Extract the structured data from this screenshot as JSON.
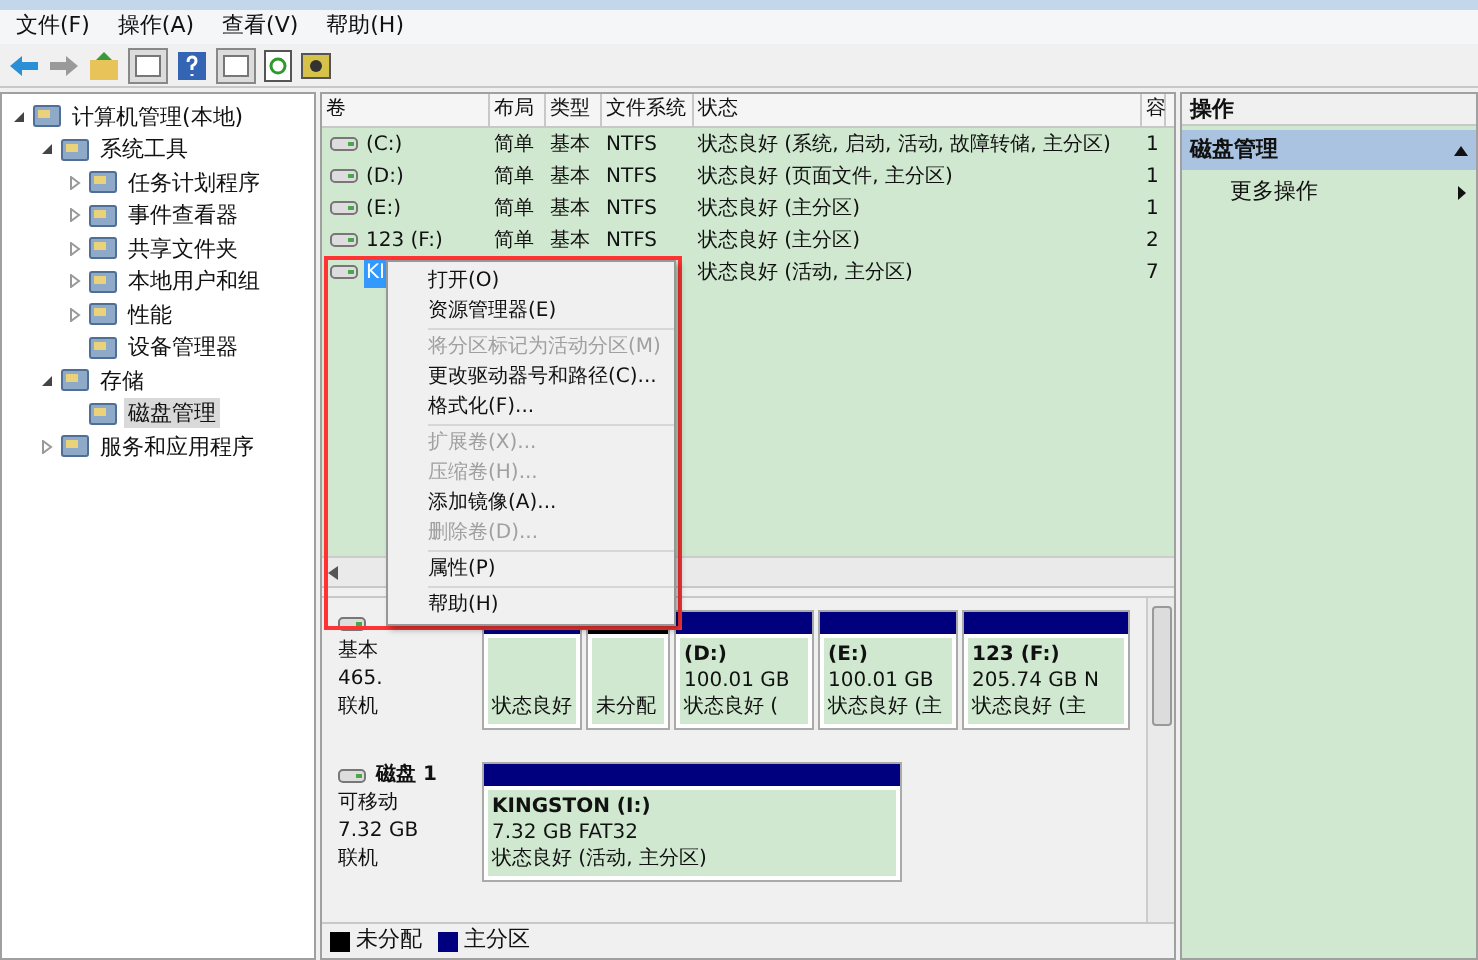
{
  "menubar": [
    "文件(F)",
    "操作(A)",
    "查看(V)",
    "帮助(H)"
  ],
  "tree": [
    {
      "label": "计算机管理(本地)",
      "expanded": true,
      "selected": false,
      "children": [
        {
          "label": "系统工具",
          "expanded": true,
          "selected": false,
          "children": [
            {
              "label": "任务计划程序",
              "expanded": false,
              "selected": false
            },
            {
              "label": "事件查看器",
              "expanded": false,
              "selected": false
            },
            {
              "label": "共享文件夹",
              "expanded": false,
              "selected": false
            },
            {
              "label": "本地用户和组",
              "expanded": false,
              "selected": false
            },
            {
              "label": "性能",
              "expanded": false,
              "selected": false
            },
            {
              "label": "设备管理器",
              "selected": false
            }
          ]
        },
        {
          "label": "存储",
          "expanded": true,
          "selected": false,
          "children": [
            {
              "label": "磁盘管理",
              "selected": true
            }
          ]
        },
        {
          "label": "服务和应用程序",
          "expanded": false,
          "selected": false
        }
      ]
    }
  ],
  "volumes": {
    "columns": [
      "卷",
      "布局",
      "类型",
      "文件系统",
      "状态",
      "容"
    ],
    "rows": [
      {
        "name": "(C:)",
        "layout": "简单",
        "type": "基本",
        "fs": "NTFS",
        "status": "状态良好 (系统, 启动, 活动, 故障转储, 主分区)",
        "capacity": "1",
        "selected": false
      },
      {
        "name": "(D:)",
        "layout": "简单",
        "type": "基本",
        "fs": "NTFS",
        "status": "状态良好 (页面文件, 主分区)",
        "capacity": "1",
        "selected": false
      },
      {
        "name": "(E:)",
        "layout": "简单",
        "type": "基本",
        "fs": "NTFS",
        "status": "状态良好 (主分区)",
        "capacity": "1",
        "selected": false
      },
      {
        "name": "123 (F:)",
        "layout": "简单",
        "type": "基本",
        "fs": "NTFS",
        "status": "状态良好 (主分区)",
        "capacity": "2",
        "selected": false
      },
      {
        "name": "KI",
        "status": "状态良好 (活动, 主分区)",
        "capacity": "7",
        "selected": true
      }
    ]
  },
  "context_menu": [
    [
      {
        "label": "打开(O)",
        "disabled": false
      },
      {
        "label": "资源管理器(E)",
        "disabled": false
      }
    ],
    [
      {
        "label": "将分区标记为活动分区(M)",
        "disabled": true
      },
      {
        "label": "更改驱动器号和路径(C)...",
        "disabled": false
      },
      {
        "label": "格式化(F)...",
        "disabled": false
      }
    ],
    [
      {
        "label": "扩展卷(X)...",
        "disabled": true
      },
      {
        "label": "压缩卷(H)...",
        "disabled": true
      },
      {
        "label": "添加镜像(A)...",
        "disabled": false
      },
      {
        "label": "删除卷(D)...",
        "disabled": true
      }
    ],
    [
      {
        "label": "属性(P)",
        "disabled": false
      }
    ],
    [
      {
        "label": "帮助(H)",
        "disabled": false
      }
    ]
  ],
  "disks": [
    {
      "lines": [
        "基本",
        "465.",
        "联机"
      ],
      "partitions": [
        {
          "kind": "primary",
          "status": "状态良好"
        },
        {
          "kind": "unallocated",
          "status": "未分配"
        },
        {
          "kind": "primary",
          "name": "(D:)",
          "size": "100.01 GB",
          "status": "状态良好 ("
        },
        {
          "kind": "primary",
          "name": "(E:)",
          "size": "100.01 GB",
          "status": "状态良好 (主"
        },
        {
          "kind": "primary",
          "name": "123   (F:)",
          "size": "205.74 GB N",
          "status": "状态良好 (主"
        }
      ]
    },
    {
      "title": "磁盘 1",
      "lines": [
        "可移动",
        "7.32 GB",
        "联机"
      ],
      "partitions": [
        {
          "kind": "primary",
          "name": "KINGSTON   (I:)",
          "size": "7.32 GB FAT32",
          "status": "状态良好 (活动, 主分区)"
        }
      ]
    }
  ],
  "legend": [
    {
      "label": "未分配",
      "color": "#000000"
    },
    {
      "label": "主分区",
      "color": "#00007f"
    }
  ],
  "actions": {
    "title": "操作",
    "items": [
      {
        "kind": "section",
        "label": "磁盘管理",
        "expanded": true
      },
      {
        "kind": "link",
        "label": "更多操作"
      }
    ]
  }
}
